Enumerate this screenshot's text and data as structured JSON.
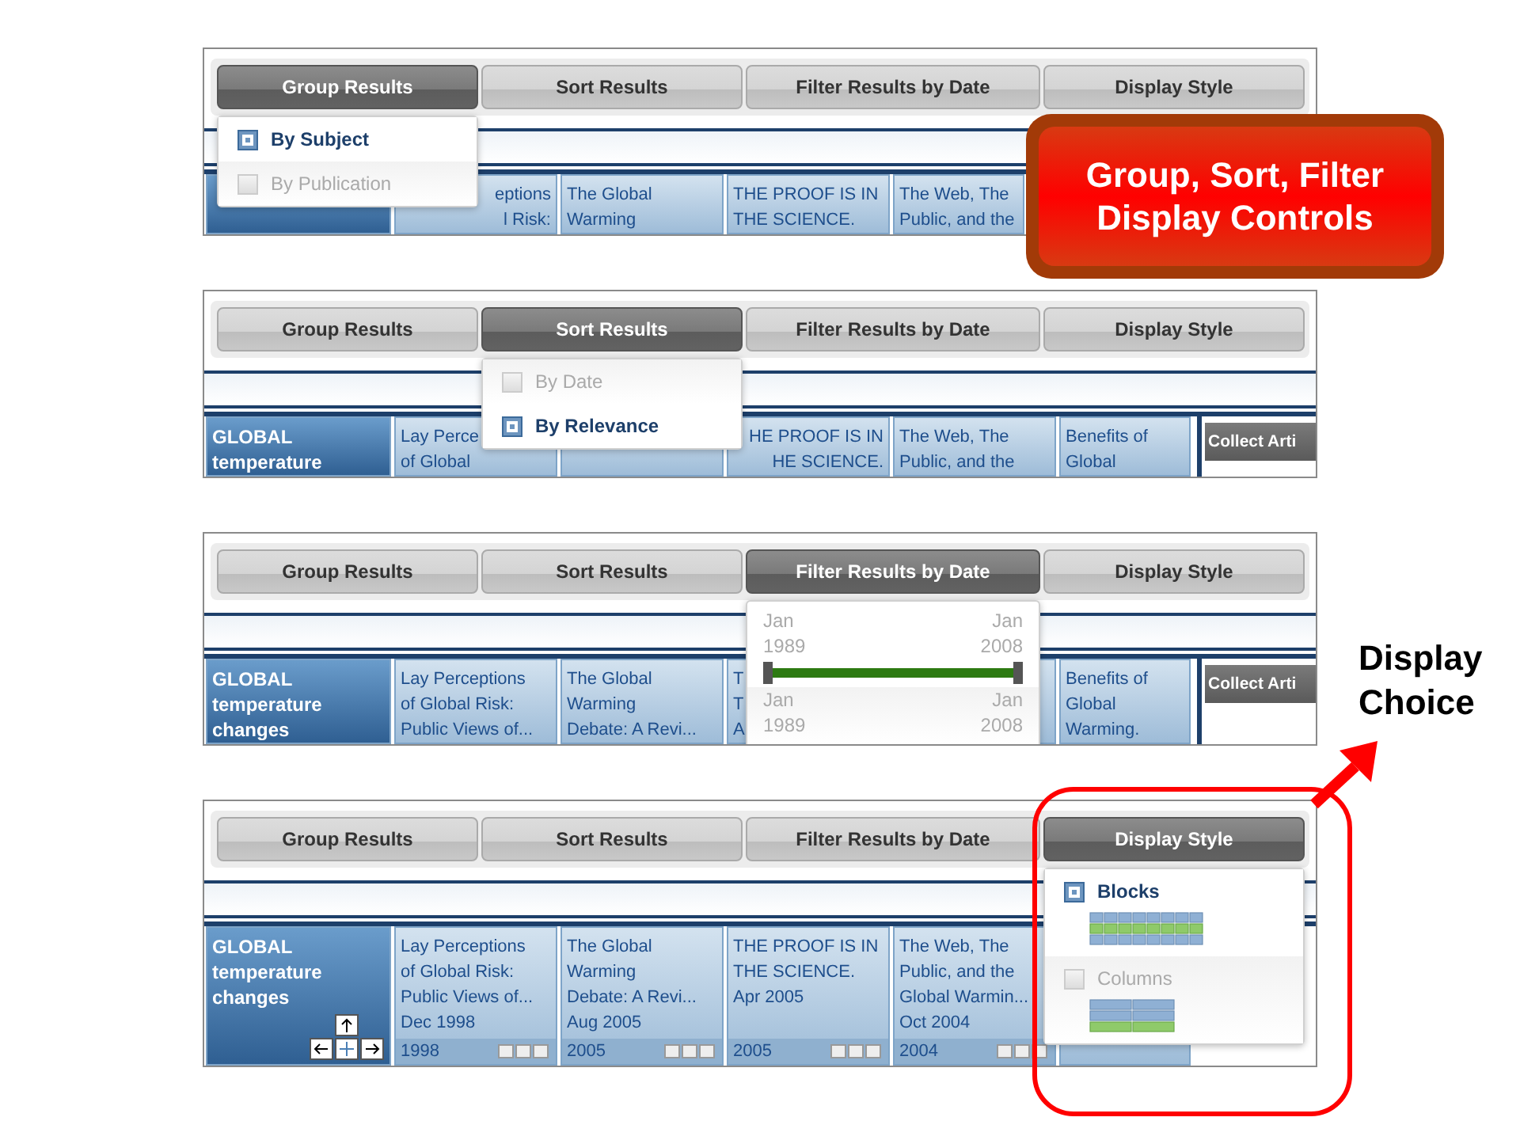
{
  "panels": [
    {
      "tabs": [
        {
          "label": "Group Results",
          "selected": true
        },
        {
          "label": "Sort Results",
          "selected": false
        },
        {
          "label": "Filter Results by Date",
          "selected": false
        },
        {
          "label": "Display Style",
          "selected": false
        }
      ],
      "menu": {
        "kind": "options",
        "options": [
          {
            "label": "By Subject",
            "selected": true
          },
          {
            "label": "By Publication",
            "selected": false
          }
        ]
      },
      "cards": [
        {
          "kind": "subject"
        },
        {
          "kind": "covered",
          "lines": [
            "eptions",
            "l Risk:"
          ]
        },
        {
          "kind": "article",
          "lines": [
            "The Global",
            "Warming"
          ]
        },
        {
          "kind": "article",
          "lines": [
            "THE PROOF IS IN",
            "THE SCIENCE."
          ]
        },
        {
          "kind": "edge",
          "lines": [
            "The Web, The",
            "Public, and the"
          ]
        }
      ]
    },
    {
      "tabs": [
        {
          "label": "Group Results",
          "selected": false
        },
        {
          "label": "Sort Results",
          "selected": true
        },
        {
          "label": "Filter Results by Date",
          "selected": false
        },
        {
          "label": "Display Style",
          "selected": false
        }
      ],
      "menu": {
        "kind": "options",
        "options": [
          {
            "label": "By Date",
            "selected": false
          },
          {
            "label": "By Relevance",
            "selected": true
          }
        ]
      },
      "cards": [
        {
          "kind": "subject",
          "lines": [
            "GLOBAL",
            "temperature"
          ]
        },
        {
          "kind": "article",
          "lines": [
            "Lay Perce",
            "of Global"
          ]
        },
        {
          "kind": "article"
        },
        {
          "kind": "covered",
          "lines": [
            "HE PROOF IS IN",
            "HE SCIENCE."
          ]
        },
        {
          "kind": "article",
          "lines": [
            "The Web, The",
            "Public, and the"
          ]
        },
        {
          "kind": "edge",
          "lines": [
            "Benefits of",
            "Global"
          ]
        }
      ],
      "collect": "Collect Arti"
    },
    {
      "tabs": [
        {
          "label": "Group Results",
          "selected": false
        },
        {
          "label": "Sort Results",
          "selected": false
        },
        {
          "label": "Filter Results by Date",
          "selected": true
        },
        {
          "label": "Display Style",
          "selected": false
        }
      ],
      "menu": {
        "kind": "date-range",
        "from": "Jan\n1989",
        "to": "Jan\n2008",
        "level": 1,
        "from_below": "Jan\n1989",
        "to_below": "Jan\n2008"
      },
      "cards": [
        {
          "kind": "subject",
          "lines": [
            "GLOBAL",
            "temperature",
            "changes"
          ]
        },
        {
          "kind": "article",
          "lines": [
            "Lay Perceptions",
            "of Global Risk:",
            "Public Views of..."
          ]
        },
        {
          "kind": "article",
          "lines": [
            "The Global",
            "Warming",
            "Debate: A Revi..."
          ]
        },
        {
          "kind": "article",
          "lines": [
            "T",
            "T",
            "A"
          ]
        },
        {
          "kind": "article"
        },
        {
          "kind": "edge",
          "lines": [
            "Benefits of",
            "Global",
            "Warming."
          ]
        }
      ],
      "collect": "Collect Arti"
    },
    {
      "tabs": [
        {
          "label": "Group Results",
          "selected": false
        },
        {
          "label": "Sort Results",
          "selected": false
        },
        {
          "label": "Filter Results by Date",
          "selected": false
        },
        {
          "label": "Display Style",
          "selected": true
        }
      ],
      "menu": {
        "kind": "styles",
        "options": [
          {
            "label": "Blocks",
            "kind": "blocks",
            "selected": true
          },
          {
            "label": "Columns",
            "kind": "columns",
            "selected": false
          }
        ]
      },
      "cards": [
        {
          "kind": "subject-nav",
          "lines": [
            "GLOBAL",
            "temperature",
            "changes"
          ]
        },
        {
          "kind": "article",
          "lines": [
            "Lay Perceptions",
            "of Global Risk:",
            "Public Views of...",
            "Dec 1998"
          ],
          "year": "1998"
        },
        {
          "kind": "article",
          "lines": [
            "The Global",
            "Warming",
            "Debate: A Revi...",
            "Aug 2005"
          ],
          "year": "2005"
        },
        {
          "kind": "article",
          "lines": [
            "THE PROOF IS IN",
            "THE SCIENCE.",
            "Apr 2005"
          ],
          "year": "2005"
        },
        {
          "kind": "article",
          "lines": [
            "The Web, The",
            "Public, and the",
            "Global Warmin...",
            "Oct 2004"
          ],
          "year": "2004"
        },
        {
          "kind": "edge"
        }
      ]
    }
  ],
  "callout": "Group, Sort, Filter\nDisplay Controls",
  "note": "Display\nChoice"
}
